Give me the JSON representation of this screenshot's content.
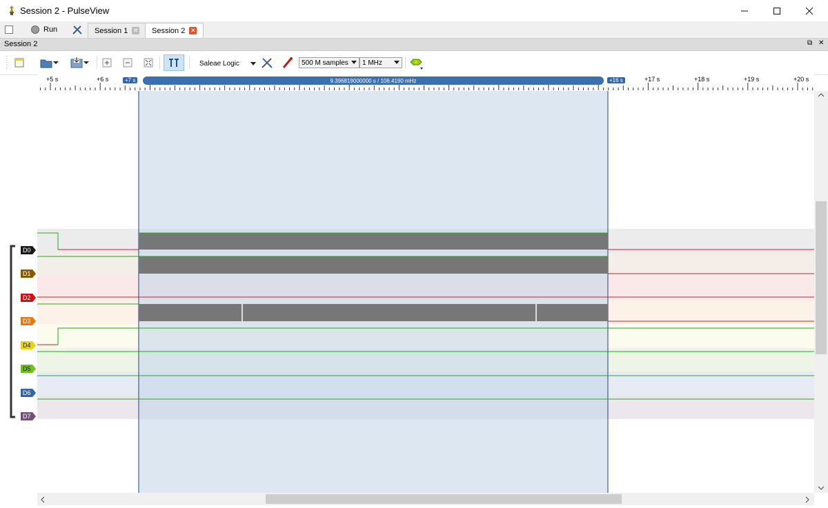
{
  "window": {
    "title": "Session 2 - PulseView",
    "minimize_icon": "minimize-icon",
    "maximize_icon": "maximize-icon",
    "close_icon": "close-icon"
  },
  "tabbar": {
    "run_label": "Run",
    "tabs": [
      {
        "label": "Session 1",
        "active": false
      },
      {
        "label": "Session 2",
        "active": true
      }
    ]
  },
  "session": {
    "header_label": "Session 2"
  },
  "toolbar": {
    "device": "Saleae Logic",
    "samples": "500 M samples",
    "samplerate": "1 MHz"
  },
  "ruler": {
    "labels": [
      "+5 s",
      "+6 s",
      "+7 s",
      "+16 s",
      "+17 s",
      "+18 s",
      "+19 s",
      "+20 s"
    ],
    "cursor_readout": "9.396819000000 s / 106.4190 mHz"
  },
  "channels": [
    {
      "name": "D0",
      "color": "#1a1a1a"
    },
    {
      "name": "D1",
      "color": "#8a5a00"
    },
    {
      "name": "D2",
      "color": "#cc1111"
    },
    {
      "name": "D3",
      "color": "#e07b18"
    },
    {
      "name": "D4",
      "color": "#e8d21c"
    },
    {
      "name": "D5",
      "color": "#70c01e"
    },
    {
      "name": "D6",
      "color": "#3465a4"
    },
    {
      "name": "D7",
      "color": "#75507b"
    }
  ],
  "colors": {
    "high": "#22aa22",
    "low": "#cc2222",
    "selection": "#dce6f2",
    "selection_border": "#1f3f7a"
  }
}
